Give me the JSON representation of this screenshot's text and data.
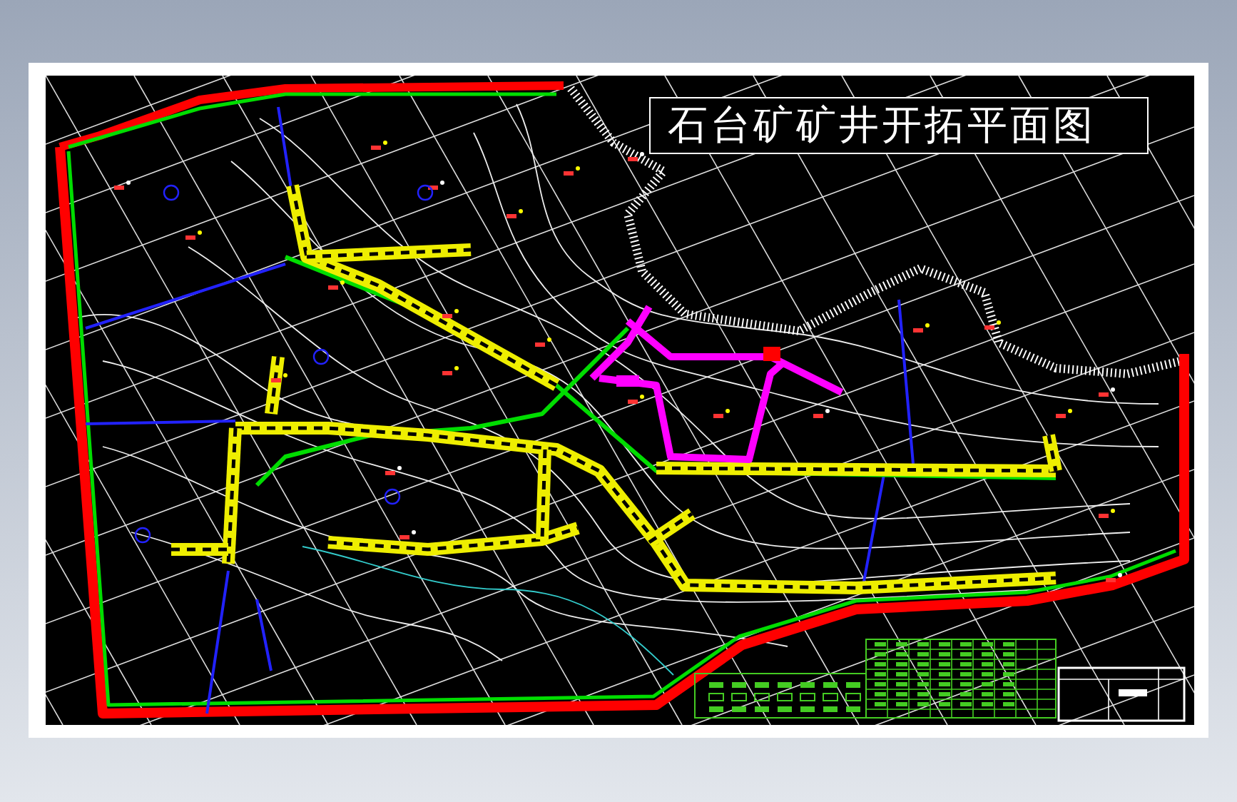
{
  "drawing": {
    "title": "石台矿矿井开拓平面图"
  }
}
